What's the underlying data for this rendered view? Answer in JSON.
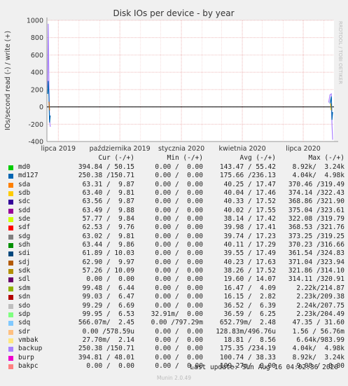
{
  "chart_data": {
    "type": "line",
    "title": "Disk IOs per device - by year",
    "ylabel": "IOs/second read (-) / write (+)",
    "xlabel": "",
    "ylim": [
      -400,
      1000
    ],
    "yticks": [
      -400,
      -200,
      0,
      200,
      400,
      600,
      800,
      1000
    ],
    "xlim": [
      "2019-06-14",
      "2020-08-16"
    ],
    "xticks": [
      {
        "date": "2019-07-01",
        "label": "lipca 2019"
      },
      {
        "date": "2019-10-01",
        "label": "października 2019"
      },
      {
        "date": "2020-01-01",
        "label": "stycznia 2020"
      },
      {
        "date": "2020-04-01",
        "label": "kwietnia 2020"
      },
      {
        "date": "2020-07-01",
        "label": "lipca 2020"
      }
    ],
    "grid": true,
    "legend": "bottom",
    "watermark": "RRDTOOL / TOBI OETIKER",
    "series_spikes": [
      {
        "name": "backup",
        "points": [
          [
            "2019-06-15",
            220
          ],
          [
            "2019-06-16",
            960
          ],
          [
            "2019-06-17",
            260
          ],
          [
            "2019-06-18",
            -150
          ],
          [
            "2019-06-19",
            -230
          ]
        ]
      },
      {
        "name": "md127",
        "points": [
          [
            "2019-06-15",
            150
          ],
          [
            "2019-06-16",
            300
          ],
          [
            "2019-06-17",
            120
          ],
          [
            "2019-06-18",
            -180
          ],
          [
            "2019-06-19",
            -100
          ]
        ]
      },
      {
        "name": "sdj",
        "points": [
          [
            "2019-06-17",
            60
          ],
          [
            "2019-06-18",
            -40
          ]
        ]
      },
      {
        "name": "backup",
        "points": [
          [
            "2020-08-08",
            50
          ],
          [
            "2020-08-10",
            140
          ],
          [
            "2020-08-12",
            150
          ],
          [
            "2020-08-13",
            -200
          ],
          [
            "2020-08-14",
            -380
          ]
        ]
      },
      {
        "name": "md127",
        "points": [
          [
            "2020-08-10",
            40
          ],
          [
            "2020-08-12",
            120
          ],
          [
            "2020-08-13",
            -150
          ],
          [
            "2020-08-14",
            -60
          ]
        ]
      },
      {
        "name": "sdk",
        "points": [
          [
            "2020-08-11",
            40
          ],
          [
            "2020-08-12",
            -40
          ]
        ]
      }
    ]
  },
  "legend_header": {
    "cur": "Cur (-/+)",
    "min": "Min (-/+)",
    "avg": "Avg (-/+)",
    "max": "Max (-/+)"
  },
  "legend_rows": [
    {
      "name": "md0",
      "color": "#00cc00",
      "cur": "394.84 / 50.15",
      "min": "0.00 /  0.00",
      "avg": "143.47 / 55.42",
      "max": "8.92k/  3.24k"
    },
    {
      "name": "md127",
      "color": "#0066b3",
      "cur": "250.38 /150.71",
      "min": "0.00 /  0.00",
      "avg": "175.66 /236.13",
      "max": "4.04k/  4.98k"
    },
    {
      "name": "sda",
      "color": "#ff8000",
      "cur": "63.31 /  9.87",
      "min": "0.00 /  0.00",
      "avg": "40.25 / 17.47",
      "max": "370.46 /319.49"
    },
    {
      "name": "sdb",
      "color": "#ffcc00",
      "cur": "63.40 /  9.81",
      "min": "0.00 /  0.00",
      "avg": "40.04 / 17.46",
      "max": "374.14 /322.43"
    },
    {
      "name": "sdc",
      "color": "#330099",
      "cur": "63.56 /  9.87",
      "min": "0.00 /  0.00",
      "avg": "40.33 / 17.52",
      "max": "368.86 /321.90"
    },
    {
      "name": "sdd",
      "color": "#990099",
      "cur": "63.49 /  9.88",
      "min": "0.00 /  0.00",
      "avg": "40.02 / 17.55",
      "max": "375.04 /323.61"
    },
    {
      "name": "sde",
      "color": "#ccff00",
      "cur": "57.77 /  9.84",
      "min": "0.00 /  0.00",
      "avg": "38.14 / 17.42",
      "max": "322.08 /319.79"
    },
    {
      "name": "sdf",
      "color": "#ff0000",
      "cur": "62.53 /  9.76",
      "min": "0.00 /  0.00",
      "avg": "39.98 / 17.41",
      "max": "368.53 /321.76"
    },
    {
      "name": "sdg",
      "color": "#808080",
      "cur": "63.02 /  9.81",
      "min": "0.00 /  0.00",
      "avg": "39.74 / 17.23",
      "max": "373.25 /319.25"
    },
    {
      "name": "sdh",
      "color": "#008f00",
      "cur": "63.44 /  9.86",
      "min": "0.00 /  0.00",
      "avg": "40.11 / 17.29",
      "max": "370.23 /316.66"
    },
    {
      "name": "sdi",
      "color": "#00487d",
      "cur": "61.89 / 10.03",
      "min": "0.00 /  0.00",
      "avg": "39.55 / 17.49",
      "max": "361.54 /324.83"
    },
    {
      "name": "sdj",
      "color": "#b35a00",
      "cur": "62.90 /  9.97",
      "min": "0.00 /  0.00",
      "avg": "40.23 / 17.63",
      "max": "371.04 /323.94"
    },
    {
      "name": "sdk",
      "color": "#b38f00",
      "cur": "57.26 / 10.09",
      "min": "0.00 /  0.00",
      "avg": "38.26 / 17.52",
      "max": "321.86 /314.10"
    },
    {
      "name": "sdl",
      "color": "#6b006b",
      "cur": "0.00 /  0.00",
      "min": "0.00 /  0.00",
      "avg": "19.60 / 14.07",
      "max": "314.11 /320.91"
    },
    {
      "name": "sdm",
      "color": "#8fb300",
      "cur": "99.48 /  6.44",
      "min": "0.00 /  0.00",
      "avg": "16.47 /  4.09",
      "max": "2.22k/214.87"
    },
    {
      "name": "sdn",
      "color": "#b30000",
      "cur": "99.03 /  6.47",
      "min": "0.00 /  0.00",
      "avg": "16.15 /  2.82",
      "max": "2.23k/209.38"
    },
    {
      "name": "sdo",
      "color": "#bebebe",
      "cur": "99.29 /  6.69",
      "min": "0.00 /  0.00",
      "avg": "36.52 /  6.39",
      "max": "2.24k/207.75"
    },
    {
      "name": "sdp",
      "color": "#80ff80",
      "cur": "99.95 /  6.53",
      "min": "32.91m/  0.00",
      "avg": "36.59 /  6.25",
      "max": "2.23k/204.49"
    },
    {
      "name": "sdq",
      "color": "#80c9ff",
      "cur": "566.07m/  2.45",
      "min": "0.00 /797.29m",
      "avg": "652.79m/  2.48",
      "max": "47.35 / 31.60"
    },
    {
      "name": "sdr",
      "color": "#ffc080",
      "cur": "0.00 /578.59u",
      "min": "0.00 /  0.00",
      "avg": "128.83m/496.76u",
      "max": "1.56 / 56.76m"
    },
    {
      "name": "vmbak",
      "color": "#ffe680",
      "cur": "27.70m/  2.14",
      "min": "0.00 /  0.00",
      "avg": "18.81 /  8.56",
      "max": "6.64k/983.99"
    },
    {
      "name": "backup",
      "color": "#aa80ff",
      "cur": "250.38 /150.71",
      "min": "0.00 /  0.00",
      "avg": "175.35 /234.19",
      "max": "4.04k/  4.98k"
    },
    {
      "name": "burp",
      "color": "#ee00cc",
      "cur": "394.81 / 48.01",
      "min": "0.00 /  0.00",
      "avg": "100.74 / 38.33",
      "max": "8.92k/  3.24k"
    },
    {
      "name": "bakpc",
      "color": "#ff8080",
      "cur": "0.00 /  0.00",
      "min": "0.00 /  0.00",
      "avg": "109.27m/  0.00",
      "max": "9.08 /  0.00"
    }
  ],
  "footer": "Last update: Sun Aug 16 04:02:36 2020",
  "version": "Munin 2.0.49"
}
